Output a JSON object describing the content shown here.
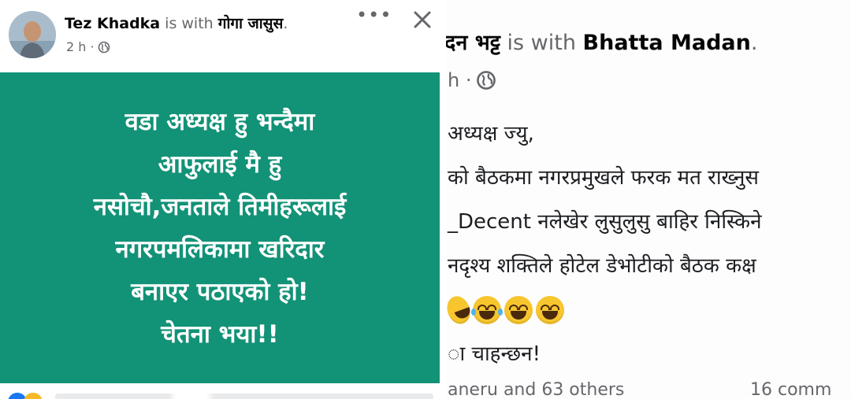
{
  "left_post": {
    "author": "Tez Khadka",
    "with_text": "is with",
    "tagged": "गोगा जासुस",
    "tagged_end": ".",
    "time": "2 h ·",
    "more_label": "•••",
    "image_text_lines": [
      "वडा अध्यक्ष हु भन्दैमा",
      "आफुलाई मै हु",
      "नसोचौ,जनताले तिमीहरूलाई",
      "नगरपमलिकामा खरिदार",
      "बनाएर पठाएको हो!",
      "चेतना भया!!"
    ],
    "bg_color": "#129277"
  },
  "right_post": {
    "author": "दन भट्ट",
    "with_text": "is with",
    "tagged": "Bhatta Madan",
    "tagged_end": ".",
    "time": "h ·",
    "text_lines": [
      "अध्यक्ष ज्यु,",
      "को बैठकमा नगरप्रमुखले फरक मत राख्नुस",
      "_Decent नलेखेर लुसुलुसु बाहिर निस्किने",
      "नदृश्य शक्तिले होटेल डेभोटीको बैठक कक्ष"
    ],
    "last_line": "ा चाहन्छन!",
    "likes": "aneru and 63 others",
    "comments": "16 comm"
  }
}
